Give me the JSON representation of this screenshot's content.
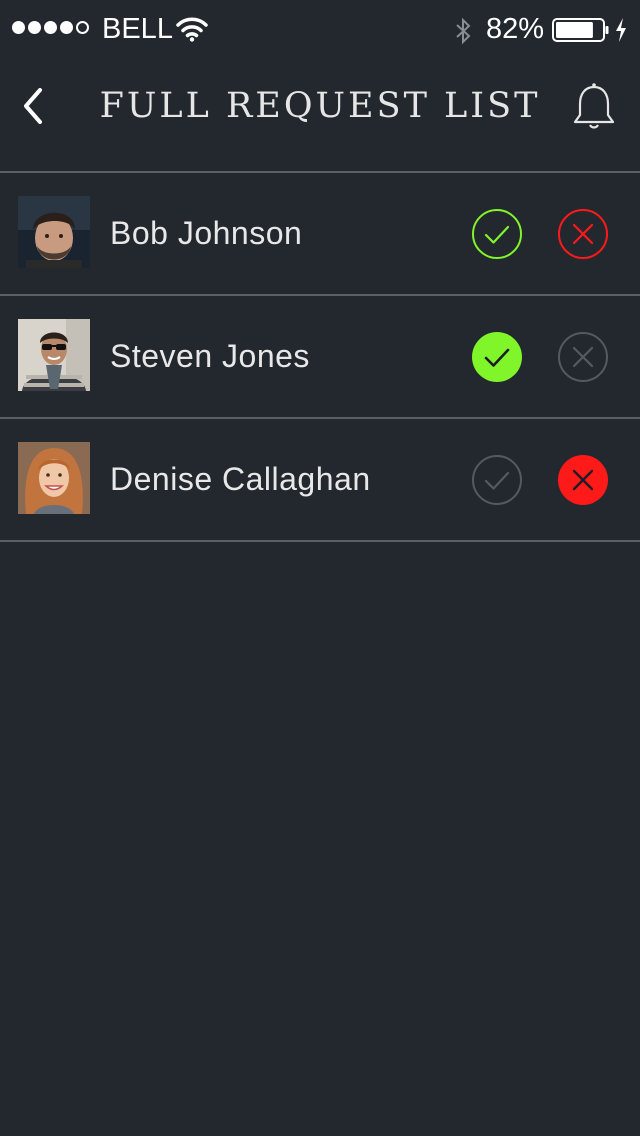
{
  "status_bar": {
    "carrier": "BELL",
    "battery_percent": "82%",
    "signal_filled_dots": 4,
    "signal_total_dots": 5,
    "battery_level": 0.82
  },
  "header": {
    "title": "FULL REQUEST LIST"
  },
  "colors": {
    "background": "#23272e",
    "divider": "#5b5f66",
    "accept": "#7ff52a",
    "decline": "#ff1a1a",
    "inactive": "#555a61"
  },
  "requests": [
    {
      "name": "Bob Johnson",
      "avatar": "avatar-man-dark-hair",
      "state": "pending"
    },
    {
      "name": "Steven Jones",
      "avatar": "avatar-man-sunglasses",
      "state": "accepted"
    },
    {
      "name": "Denise Callaghan",
      "avatar": "avatar-woman-red-hair",
      "state": "declined"
    }
  ]
}
